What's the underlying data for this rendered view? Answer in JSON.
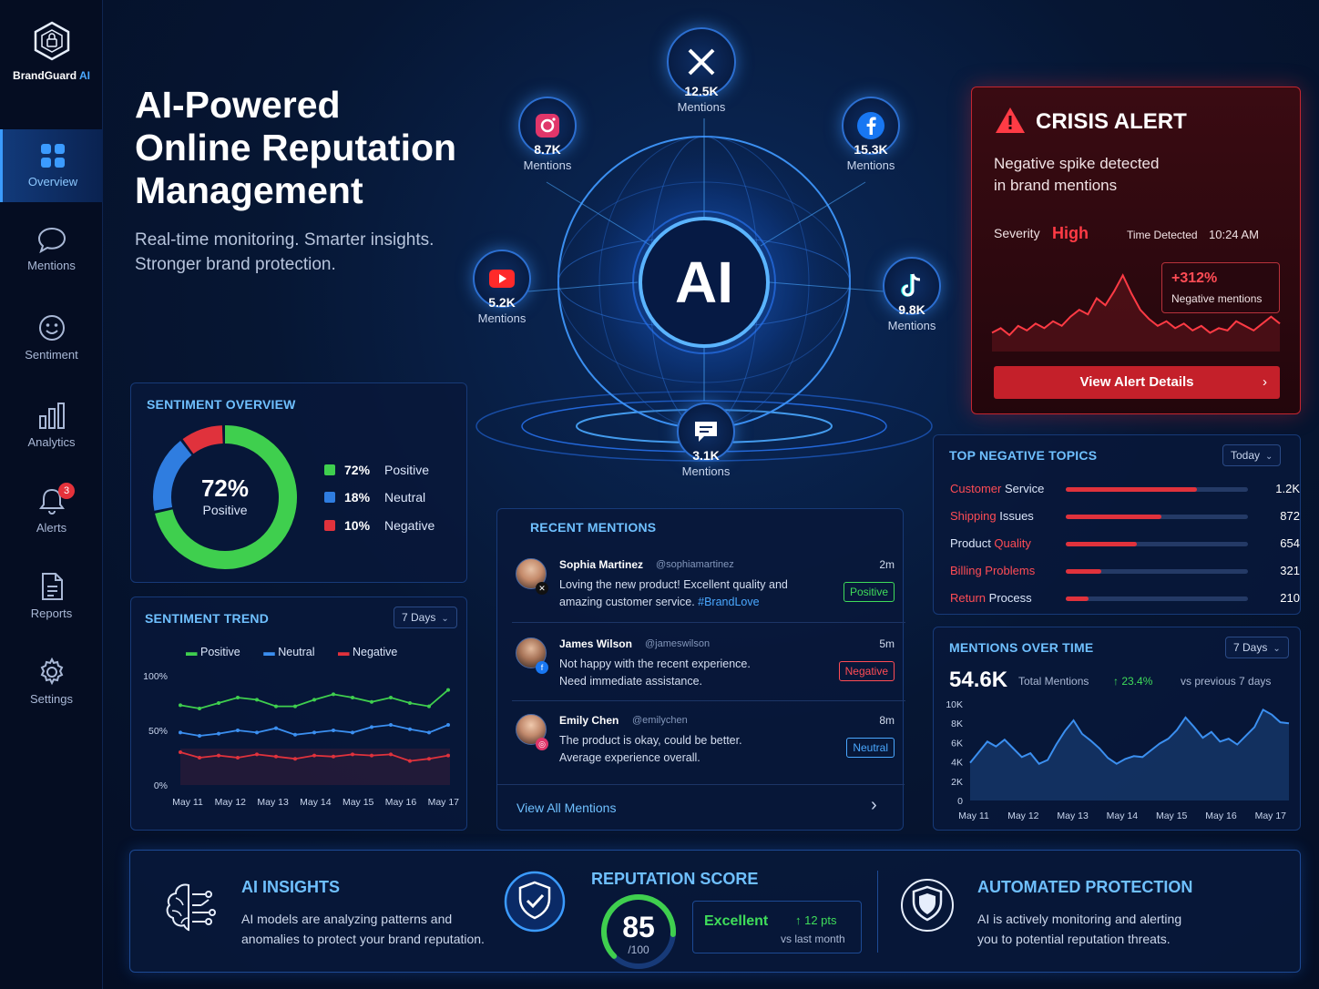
{
  "brand": {
    "name": "BrandGuard",
    "ai": "AI"
  },
  "nav": [
    {
      "label": "Overview",
      "icon": "grid-icon"
    },
    {
      "label": "Mentions",
      "icon": "chat-bubble-icon"
    },
    {
      "label": "Sentiment",
      "icon": "smiley-icon"
    },
    {
      "label": "Analytics",
      "icon": "bar-chart-icon"
    },
    {
      "label": "Alerts",
      "icon": "bell-icon",
      "badge": "3"
    },
    {
      "label": "Reports",
      "icon": "document-icon"
    },
    {
      "label": "Settings",
      "icon": "gear-icon"
    }
  ],
  "hero": {
    "title_line1": "AI-Powered",
    "title_line2": "Online Reputation",
    "title_line3": "Management",
    "subtitle_line1": "Real-time monitoring. Smarter insights.",
    "subtitle_line2": "Stronger brand protection."
  },
  "globe": {
    "center": "AI",
    "channels": [
      {
        "network": "x",
        "icon": "x-icon",
        "value": "12.5K",
        "label": "Mentions"
      },
      {
        "network": "instagram",
        "icon": "instagram-icon",
        "value": "8.7K",
        "label": "Mentions"
      },
      {
        "network": "facebook",
        "icon": "facebook-icon",
        "value": "15.3K",
        "label": "Mentions"
      },
      {
        "network": "youtube",
        "icon": "youtube-icon",
        "value": "5.2K",
        "label": "Mentions"
      },
      {
        "network": "tiktok",
        "icon": "tiktok-icon",
        "value": "9.8K",
        "label": "Mentions"
      },
      {
        "network": "forums",
        "icon": "message-icon",
        "value": "3.1K",
        "label": "Mentions"
      }
    ]
  },
  "crisis": {
    "title": "CRISIS ALERT",
    "desc_line1": "Negative spike detected",
    "desc_line2": "in brand mentions",
    "severity_label": "Severity",
    "severity_value": "High",
    "time_label": "Time Detected",
    "time_value": "10:24 AM",
    "spike_pct": "+312%",
    "spike_label": "Negative mentions",
    "button": "View Alert Details"
  },
  "sentiment_overview": {
    "title": "SENTIMENT OVERVIEW",
    "center_value": "72%",
    "center_label": "Positive",
    "items": [
      {
        "pct": "72%",
        "label": "Positive",
        "color": "#3fcf4e"
      },
      {
        "pct": "18%",
        "label": "Neutral",
        "color": "#2f7de0"
      },
      {
        "pct": "10%",
        "label": "Negative",
        "color": "#e0323c"
      }
    ]
  },
  "sentiment_trend": {
    "title": "SENTIMENT TREND",
    "range": "7 Days",
    "legend": [
      "Positive",
      "Neutral",
      "Negative"
    ],
    "y_ticks": [
      "100%",
      "50%",
      "0%"
    ],
    "x_ticks": [
      "May 11",
      "May 12",
      "May 13",
      "May 14",
      "May 15",
      "May 16",
      "May 17"
    ]
  },
  "top_negative": {
    "title": "TOP NEGATIVE TOPICS",
    "range": "Today",
    "topics": [
      {
        "red": "Customer",
        "rest": " Service",
        "count": "1.2K",
        "value": 1200
      },
      {
        "red": "Shipping",
        "rest": " Issues",
        "count": "872",
        "value": 872
      },
      {
        "pre": "Product ",
        "red": "Quality",
        "count": "654",
        "value": 654
      },
      {
        "red": "Billing Problems",
        "count": "321",
        "value": 321
      },
      {
        "red": "Return",
        "rest": " Process",
        "count": "210",
        "value": 210
      }
    ]
  },
  "recent_mentions": {
    "title": "RECENT MENTIONS",
    "items": [
      {
        "name": "Sophia Martinez",
        "handle": "@sophiamartinez",
        "line1": "Loving the new product! Excellent quality and",
        "line2": "amazing customer service. ",
        "tag": "#BrandLove",
        "time": "2m",
        "sentiment": "Positive",
        "network": "x"
      },
      {
        "name": "James Wilson",
        "handle": "@jameswilson",
        "line1": "Not happy with the recent experience.",
        "line2": "Need immediate assistance.",
        "tag": "",
        "time": "5m",
        "sentiment": "Negative",
        "network": "facebook"
      },
      {
        "name": "Emily Chen",
        "handle": "@emilychen",
        "line1": "The product is okay, could be better.",
        "line2": "Average experience overall.",
        "tag": "",
        "time": "8m",
        "sentiment": "Neutral",
        "network": "instagram"
      }
    ],
    "view_all": "View All Mentions"
  },
  "mentions_over_time": {
    "title": "MENTIONS OVER TIME",
    "range": "7 Days",
    "total": "54.6K",
    "total_label": "Total Mentions",
    "change": "↑ 23.4%",
    "change_label": "vs previous 7 days",
    "y_ticks": [
      "10K",
      "8K",
      "6K",
      "4K",
      "2K",
      "0"
    ],
    "x_ticks": [
      "May 11",
      "May 12",
      "May 13",
      "May 14",
      "May 15",
      "May 16",
      "May 17"
    ]
  },
  "bottom": {
    "insights_title": "AI INSIGHTS",
    "insights_line1": "AI models are analyzing patterns and",
    "insights_line2": "anomalies to protect your brand reputation.",
    "score_title": "REPUTATION SCORE",
    "score": "85",
    "score_max": "/100",
    "score_fraction": 0.85,
    "score_label": "Excellent",
    "score_change": "↑ 12 pts",
    "score_change_label": "vs last month",
    "protect_title": "AUTOMATED PROTECTION",
    "protect_line1": "AI is actively monitoring and alerting",
    "protect_line2": "you to potential reputation threats."
  },
  "chart_data": [
    {
      "type": "line",
      "title": "SENTIMENT TREND",
      "x": [
        "May 11",
        "May 12",
        "May 13",
        "May 14",
        "May 15",
        "May 16",
        "May 17"
      ],
      "ylim": [
        0,
        100
      ],
      "series": [
        {
          "name": "Positive",
          "color": "#3fcf4e",
          "values": [
            73,
            70,
            75,
            80,
            78,
            72,
            72,
            78,
            83,
            80,
            76,
            80,
            75,
            72,
            87
          ]
        },
        {
          "name": "Neutral",
          "color": "#3b8ff0",
          "values": [
            48,
            45,
            47,
            50,
            48,
            52,
            46,
            48,
            50,
            48,
            53,
            55,
            51,
            48,
            55
          ]
        },
        {
          "name": "Negative",
          "color": "#e0323c",
          "values": [
            30,
            25,
            27,
            25,
            28,
            26,
            24,
            27,
            26,
            28,
            27,
            28,
            22,
            24,
            27
          ]
        }
      ]
    },
    {
      "type": "area",
      "title": "MENTIONS OVER TIME",
      "x": [
        "May 11",
        "May 12",
        "May 13",
        "May 14",
        "May 15",
        "May 16",
        "May 17"
      ],
      "ylim": [
        0,
        10000
      ],
      "series": [
        {
          "name": "Total Mentions",
          "color": "#3b8ff0",
          "values": [
            3900,
            5000,
            6100,
            5600,
            6300,
            5400,
            4500,
            4900,
            3800,
            4200,
            5800,
            7200,
            8300,
            6900,
            6200,
            5400,
            4400,
            3800,
            4300,
            4600,
            4500,
            5200,
            5900,
            6400,
            7300,
            8600,
            7600,
            6500,
            7100,
            6100,
            6400,
            5800,
            6700,
            7600,
            9400,
            8900,
            8100,
            8000
          ]
        }
      ]
    },
    {
      "type": "line",
      "title": "Negative mentions",
      "series": [
        {
          "name": "Negative mentions",
          "color": "#ff3b45",
          "values": [
            10,
            14,
            8,
            16,
            12,
            18,
            14,
            20,
            16,
            24,
            30,
            26,
            40,
            34,
            46,
            60,
            44,
            30,
            22,
            16,
            20,
            14,
            18,
            12,
            16,
            10,
            14,
            12,
            20,
            16,
            12,
            18,
            24,
            18
          ]
        }
      ]
    },
    {
      "type": "pie",
      "title": "SENTIMENT OVERVIEW",
      "categories": [
        "Positive",
        "Neutral",
        "Negative"
      ],
      "values": [
        72,
        18,
        10
      ]
    }
  ]
}
